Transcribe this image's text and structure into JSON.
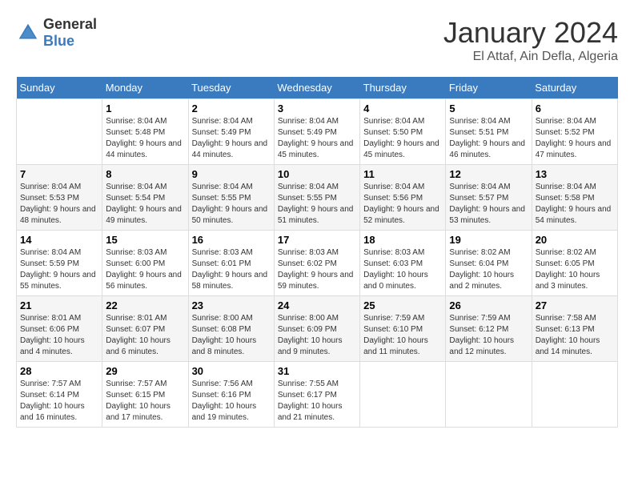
{
  "logo": {
    "general": "General",
    "blue": "Blue"
  },
  "title": "January 2024",
  "subtitle": "El Attaf, Ain Defla, Algeria",
  "weekdays": [
    "Sunday",
    "Monday",
    "Tuesday",
    "Wednesday",
    "Thursday",
    "Friday",
    "Saturday"
  ],
  "weeks": [
    [
      {
        "day": "",
        "content": ""
      },
      {
        "day": "1",
        "sunrise": "Sunrise: 8:04 AM",
        "sunset": "Sunset: 5:48 PM",
        "daylight": "Daylight: 9 hours and 44 minutes."
      },
      {
        "day": "2",
        "sunrise": "Sunrise: 8:04 AM",
        "sunset": "Sunset: 5:49 PM",
        "daylight": "Daylight: 9 hours and 44 minutes."
      },
      {
        "day": "3",
        "sunrise": "Sunrise: 8:04 AM",
        "sunset": "Sunset: 5:49 PM",
        "daylight": "Daylight: 9 hours and 45 minutes."
      },
      {
        "day": "4",
        "sunrise": "Sunrise: 8:04 AM",
        "sunset": "Sunset: 5:50 PM",
        "daylight": "Daylight: 9 hours and 45 minutes."
      },
      {
        "day": "5",
        "sunrise": "Sunrise: 8:04 AM",
        "sunset": "Sunset: 5:51 PM",
        "daylight": "Daylight: 9 hours and 46 minutes."
      },
      {
        "day": "6",
        "sunrise": "Sunrise: 8:04 AM",
        "sunset": "Sunset: 5:52 PM",
        "daylight": "Daylight: 9 hours and 47 minutes."
      }
    ],
    [
      {
        "day": "7",
        "sunrise": "Sunrise: 8:04 AM",
        "sunset": "Sunset: 5:53 PM",
        "daylight": "Daylight: 9 hours and 48 minutes."
      },
      {
        "day": "8",
        "sunrise": "Sunrise: 8:04 AM",
        "sunset": "Sunset: 5:54 PM",
        "daylight": "Daylight: 9 hours and 49 minutes."
      },
      {
        "day": "9",
        "sunrise": "Sunrise: 8:04 AM",
        "sunset": "Sunset: 5:55 PM",
        "daylight": "Daylight: 9 hours and 50 minutes."
      },
      {
        "day": "10",
        "sunrise": "Sunrise: 8:04 AM",
        "sunset": "Sunset: 5:55 PM",
        "daylight": "Daylight: 9 hours and 51 minutes."
      },
      {
        "day": "11",
        "sunrise": "Sunrise: 8:04 AM",
        "sunset": "Sunset: 5:56 PM",
        "daylight": "Daylight: 9 hours and 52 minutes."
      },
      {
        "day": "12",
        "sunrise": "Sunrise: 8:04 AM",
        "sunset": "Sunset: 5:57 PM",
        "daylight": "Daylight: 9 hours and 53 minutes."
      },
      {
        "day": "13",
        "sunrise": "Sunrise: 8:04 AM",
        "sunset": "Sunset: 5:58 PM",
        "daylight": "Daylight: 9 hours and 54 minutes."
      }
    ],
    [
      {
        "day": "14",
        "sunrise": "Sunrise: 8:04 AM",
        "sunset": "Sunset: 5:59 PM",
        "daylight": "Daylight: 9 hours and 55 minutes."
      },
      {
        "day": "15",
        "sunrise": "Sunrise: 8:03 AM",
        "sunset": "Sunset: 6:00 PM",
        "daylight": "Daylight: 9 hours and 56 minutes."
      },
      {
        "day": "16",
        "sunrise": "Sunrise: 8:03 AM",
        "sunset": "Sunset: 6:01 PM",
        "daylight": "Daylight: 9 hours and 58 minutes."
      },
      {
        "day": "17",
        "sunrise": "Sunrise: 8:03 AM",
        "sunset": "Sunset: 6:02 PM",
        "daylight": "Daylight: 9 hours and 59 minutes."
      },
      {
        "day": "18",
        "sunrise": "Sunrise: 8:03 AM",
        "sunset": "Sunset: 6:03 PM",
        "daylight": "Daylight: 10 hours and 0 minutes."
      },
      {
        "day": "19",
        "sunrise": "Sunrise: 8:02 AM",
        "sunset": "Sunset: 6:04 PM",
        "daylight": "Daylight: 10 hours and 2 minutes."
      },
      {
        "day": "20",
        "sunrise": "Sunrise: 8:02 AM",
        "sunset": "Sunset: 6:05 PM",
        "daylight": "Daylight: 10 hours and 3 minutes."
      }
    ],
    [
      {
        "day": "21",
        "sunrise": "Sunrise: 8:01 AM",
        "sunset": "Sunset: 6:06 PM",
        "daylight": "Daylight: 10 hours and 4 minutes."
      },
      {
        "day": "22",
        "sunrise": "Sunrise: 8:01 AM",
        "sunset": "Sunset: 6:07 PM",
        "daylight": "Daylight: 10 hours and 6 minutes."
      },
      {
        "day": "23",
        "sunrise": "Sunrise: 8:00 AM",
        "sunset": "Sunset: 6:08 PM",
        "daylight": "Daylight: 10 hours and 8 minutes."
      },
      {
        "day": "24",
        "sunrise": "Sunrise: 8:00 AM",
        "sunset": "Sunset: 6:09 PM",
        "daylight": "Daylight: 10 hours and 9 minutes."
      },
      {
        "day": "25",
        "sunrise": "Sunrise: 7:59 AM",
        "sunset": "Sunset: 6:10 PM",
        "daylight": "Daylight: 10 hours and 11 minutes."
      },
      {
        "day": "26",
        "sunrise": "Sunrise: 7:59 AM",
        "sunset": "Sunset: 6:12 PM",
        "daylight": "Daylight: 10 hours and 12 minutes."
      },
      {
        "day": "27",
        "sunrise": "Sunrise: 7:58 AM",
        "sunset": "Sunset: 6:13 PM",
        "daylight": "Daylight: 10 hours and 14 minutes."
      }
    ],
    [
      {
        "day": "28",
        "sunrise": "Sunrise: 7:57 AM",
        "sunset": "Sunset: 6:14 PM",
        "daylight": "Daylight: 10 hours and 16 minutes."
      },
      {
        "day": "29",
        "sunrise": "Sunrise: 7:57 AM",
        "sunset": "Sunset: 6:15 PM",
        "daylight": "Daylight: 10 hours and 17 minutes."
      },
      {
        "day": "30",
        "sunrise": "Sunrise: 7:56 AM",
        "sunset": "Sunset: 6:16 PM",
        "daylight": "Daylight: 10 hours and 19 minutes."
      },
      {
        "day": "31",
        "sunrise": "Sunrise: 7:55 AM",
        "sunset": "Sunset: 6:17 PM",
        "daylight": "Daylight: 10 hours and 21 minutes."
      },
      {
        "day": "",
        "content": ""
      },
      {
        "day": "",
        "content": ""
      },
      {
        "day": "",
        "content": ""
      }
    ]
  ]
}
